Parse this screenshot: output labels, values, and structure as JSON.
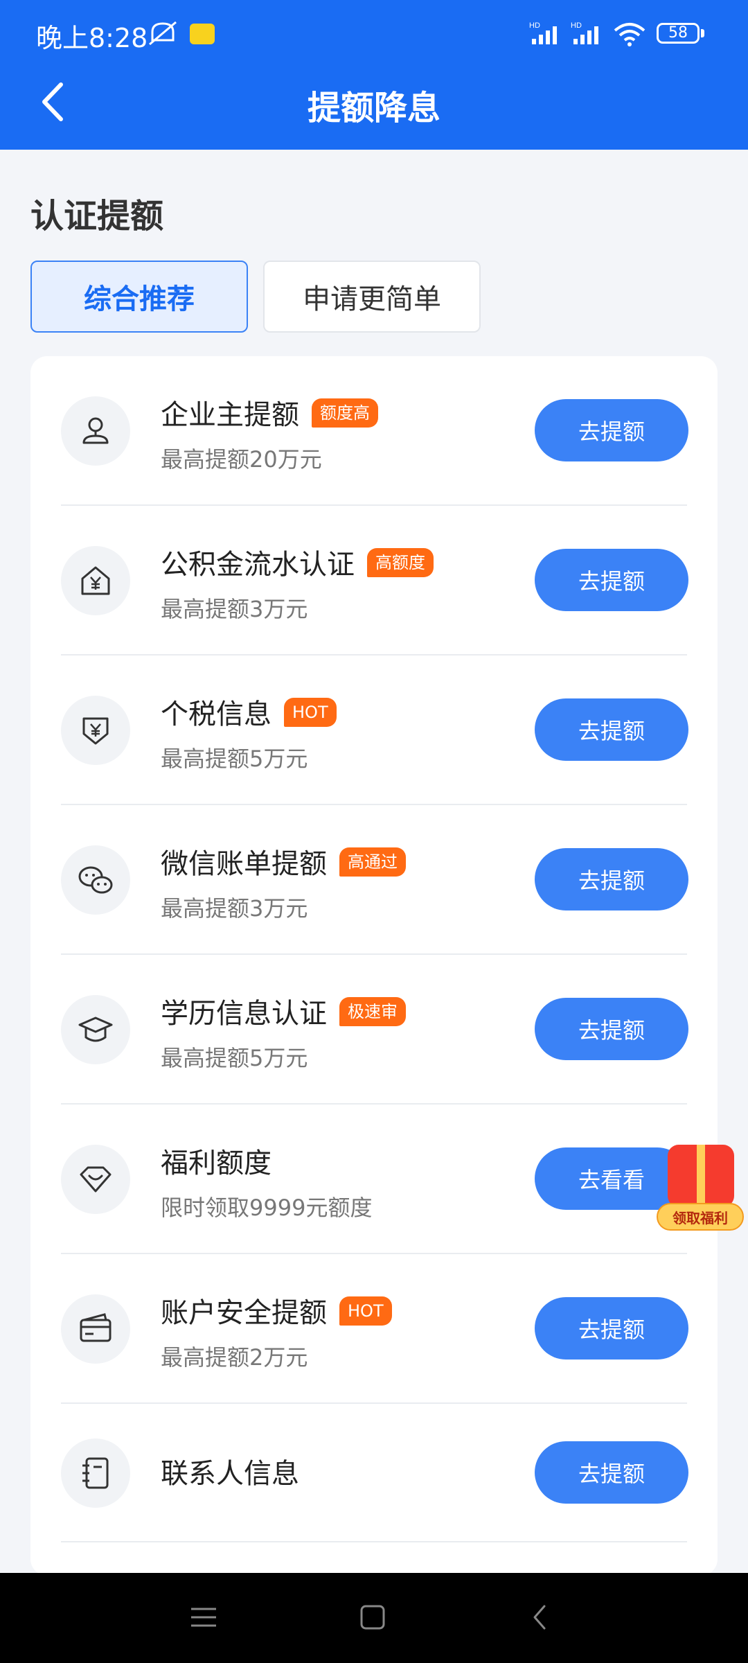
{
  "status_bar": {
    "time": "晚上8:28",
    "battery": "58",
    "hd_label": "HD"
  },
  "header": {
    "title": "提额降息",
    "back_icon": "chevron-left-icon"
  },
  "section": {
    "title": "认证提额"
  },
  "tabs": [
    {
      "label": "综合推荐",
      "active": true
    },
    {
      "label": "申请更简单",
      "active": false
    }
  ],
  "items": [
    {
      "title": "企业主提额",
      "badge": "额度高",
      "subtitle": "最高提额20万元",
      "button": "去提额",
      "icon": "person-icon"
    },
    {
      "title": "公积金流水认证",
      "badge": "高额度",
      "subtitle": "最高提额3万元",
      "button": "去提额",
      "icon": "house-yen-icon"
    },
    {
      "title": "个税信息",
      "badge": "HOT",
      "subtitle": "最高提额5万元",
      "button": "去提额",
      "icon": "shield-yen-icon"
    },
    {
      "title": "微信账单提额",
      "badge": "高通过",
      "subtitle": "最高提额3万元",
      "button": "去提额",
      "icon": "wechat-icon"
    },
    {
      "title": "学历信息认证",
      "badge": "极速审",
      "subtitle": "最高提额5万元",
      "button": "去提额",
      "icon": "graduation-cap-icon"
    },
    {
      "title": "福利额度",
      "badge": "",
      "subtitle": "限时领取9999元额度",
      "button": "去看看",
      "icon": "gift-heart-icon"
    },
    {
      "title": "账户安全提额",
      "badge": "HOT",
      "subtitle": "最高提额2万元",
      "button": "去提额",
      "icon": "card-icon"
    },
    {
      "title": "联系人信息",
      "badge": "",
      "subtitle": "",
      "button": "去提额",
      "icon": "contacts-book-icon"
    }
  ],
  "float_gift": {
    "label": "领取福利"
  },
  "colors": {
    "brand": "#1a6cf3",
    "button": "#3b82f6",
    "badge": "#ff6a13"
  }
}
